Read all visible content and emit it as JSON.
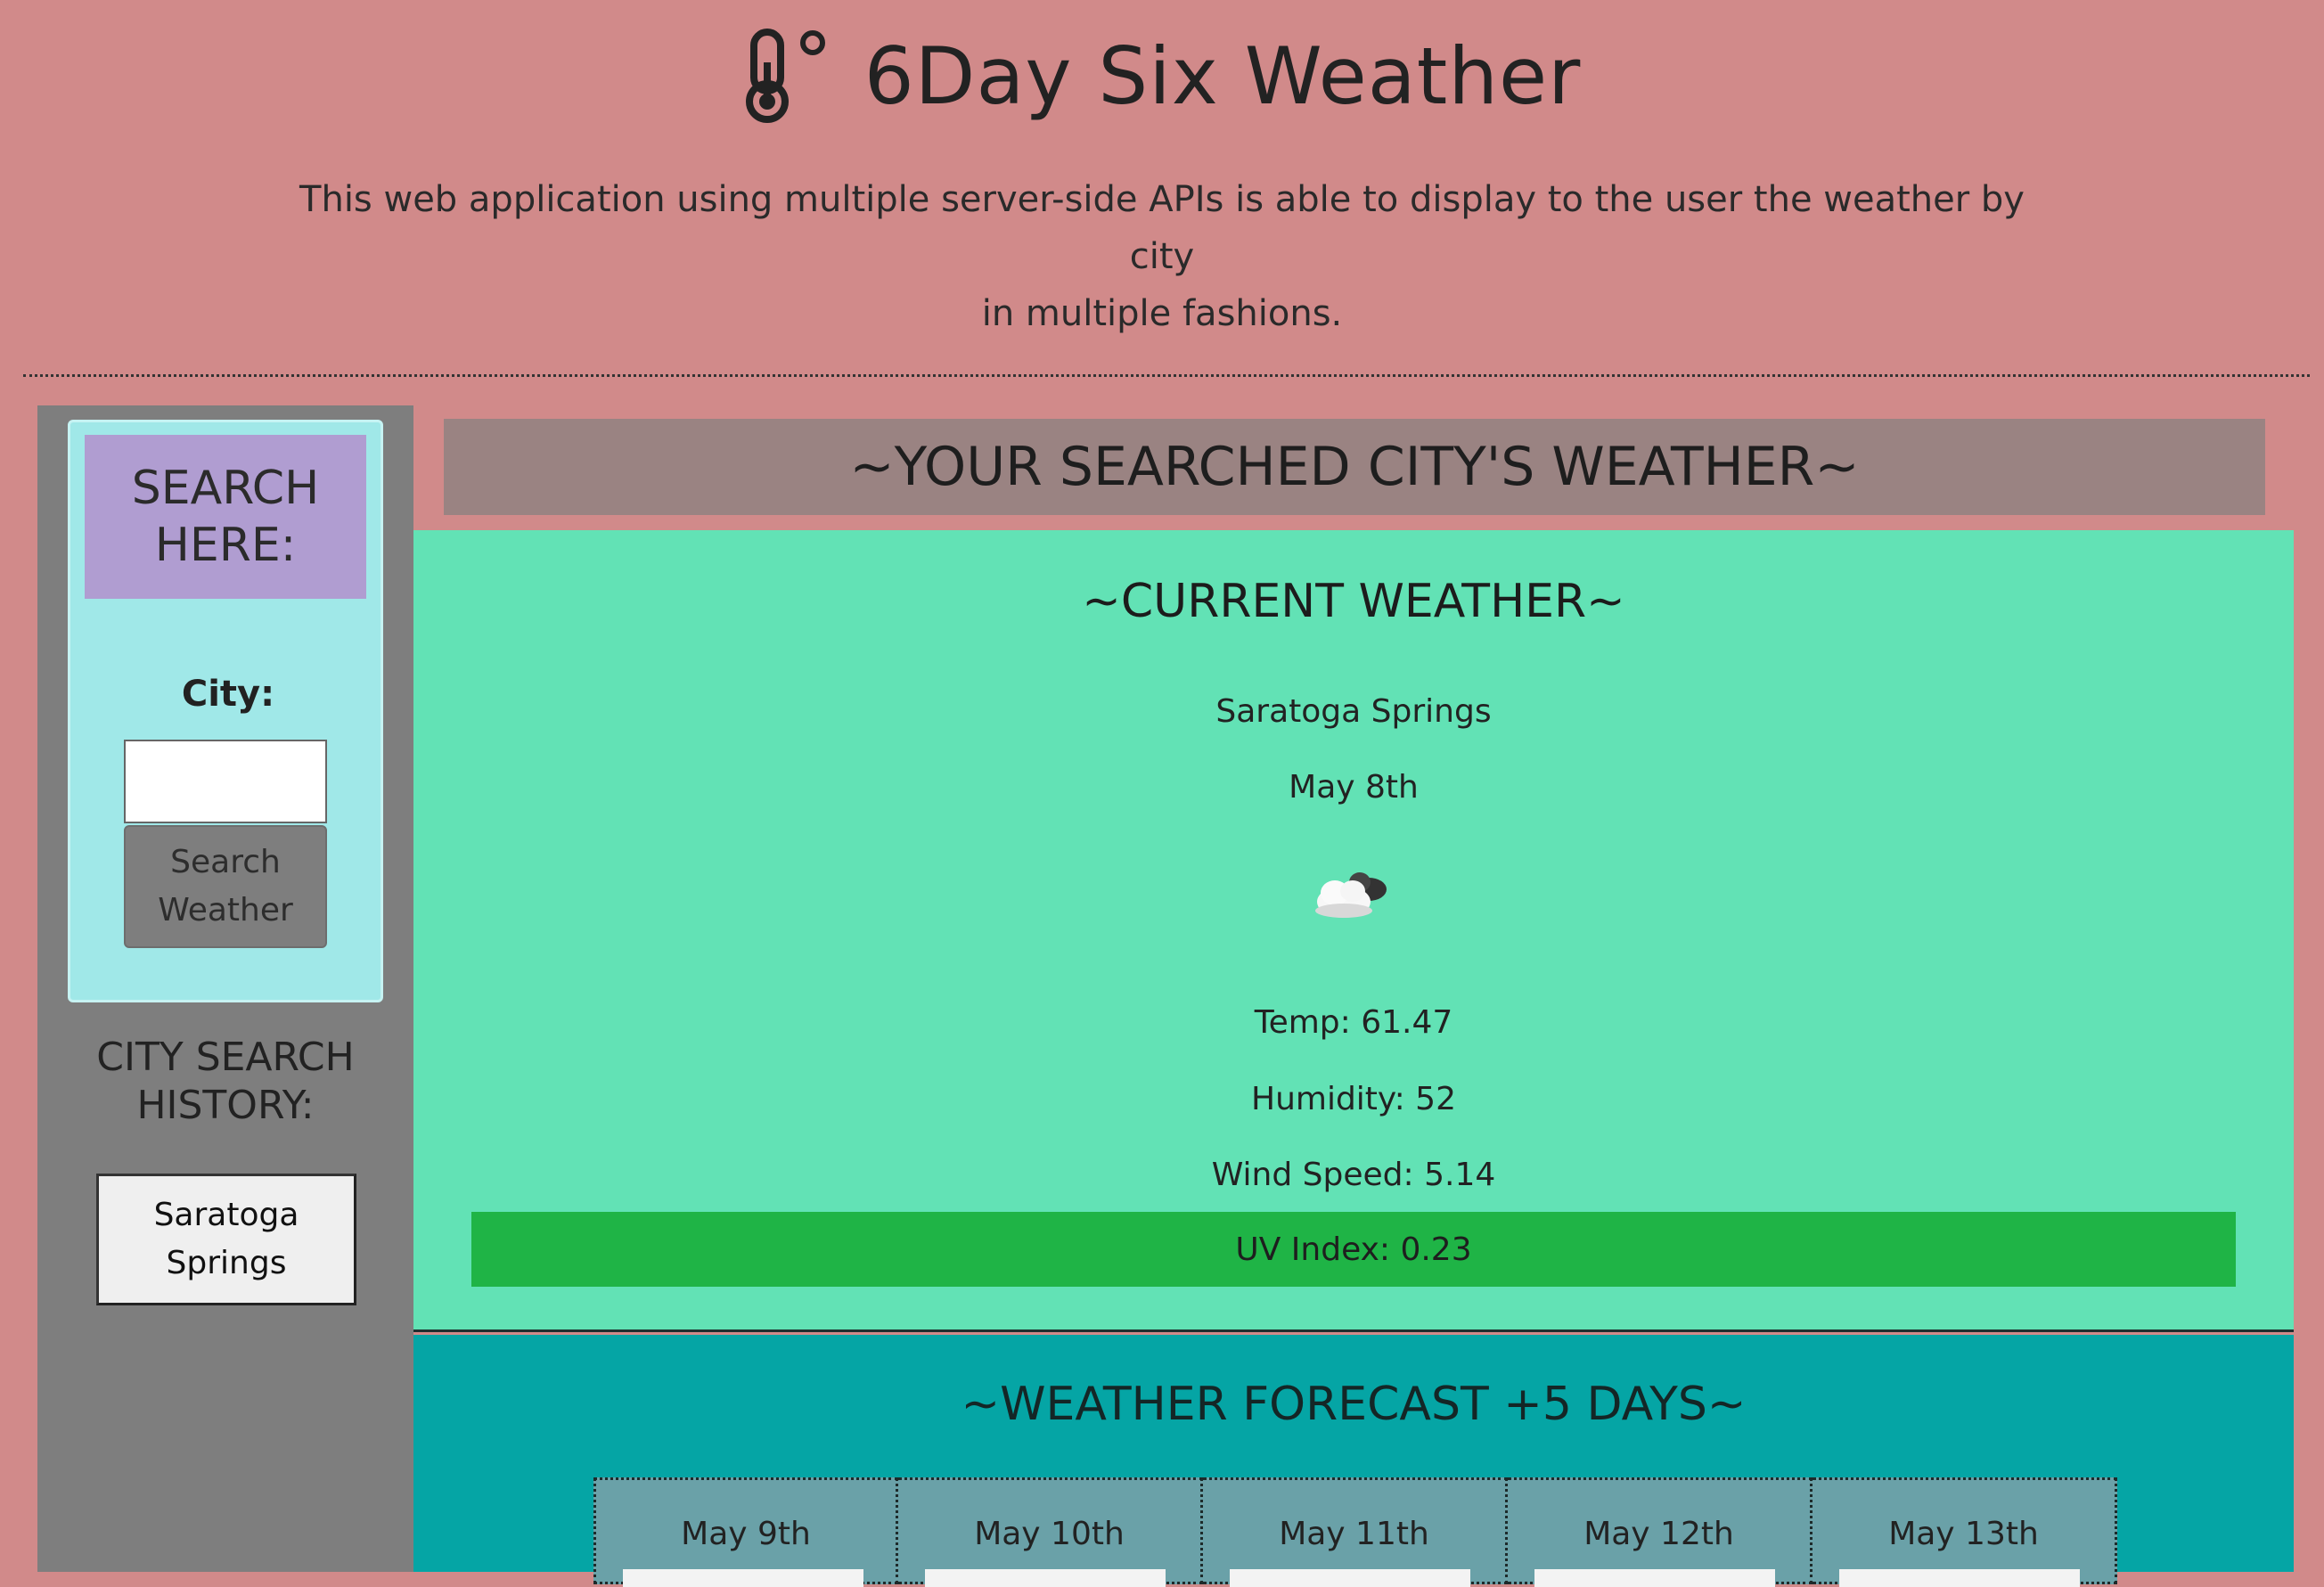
{
  "header": {
    "title": "6Day Six Weather",
    "lead_line1": "This web application using multiple server-side APIs is able to display to the user the weather by city",
    "lead_line2": "in multiple fashions."
  },
  "sidebar": {
    "search_heading_line1": "SEARCH",
    "search_heading_line2": "HERE:",
    "city_label": "City:",
    "city_input_value": "",
    "search_button_line1": "Search",
    "search_button_line2": "Weather",
    "history_heading_line1": "CITY SEARCH",
    "history_heading_line2": "HISTORY:",
    "history_items": [
      {
        "line1": "Saratoga",
        "line2": "Springs"
      }
    ]
  },
  "main": {
    "heading": "~YOUR SEARCHED CITY'S WEATHER~",
    "current": {
      "heading": "~CURRENT WEATHER~",
      "city": "Saratoga Springs",
      "date": "May 8th",
      "icon": "cloudy-icon",
      "temp": "Temp: 61.47",
      "humidity": "Humidity: 52",
      "wind": "Wind Speed: 5.14",
      "uv": "UV Index: 0.23",
      "uv_color": "#1fb446"
    },
    "forecast": {
      "heading": "~WEATHER FORECAST +5 DAYS~",
      "days": [
        {
          "date": "May 9th"
        },
        {
          "date": "May 10th"
        },
        {
          "date": "May 11th"
        },
        {
          "date": "May 12th"
        },
        {
          "date": "May 13th"
        }
      ]
    }
  },
  "colors": {
    "page_bg": "#d18a8a",
    "current_bg": "#62e2b5",
    "forecast_bg": "#05a5a5",
    "search_card_bg": "#a0e8e8",
    "search_heading_bg": "#b09dd1"
  }
}
